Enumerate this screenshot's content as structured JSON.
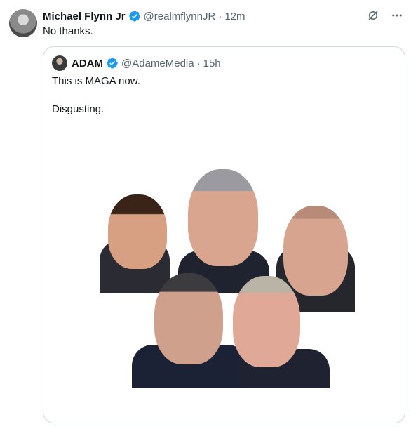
{
  "tweet": {
    "author_name": "Michael Flynn Jr",
    "handle": "@realmflynnJR",
    "separator": "·",
    "time": "12m",
    "text": "No thanks."
  },
  "quoted": {
    "author_name": "ADAM",
    "handle": "@AdameMedia",
    "separator": "·",
    "time": "15h",
    "lines": [
      "This is MAGA now.",
      "Disgusting."
    ]
  },
  "icons": {
    "verified": "verified-badge-icon",
    "grok": "grok-icon",
    "more": "more-icon"
  },
  "colors": {
    "verified": "#1d9bf0",
    "text": "#0f1419",
    "secondary": "#536471",
    "border": "#cfd9de"
  }
}
